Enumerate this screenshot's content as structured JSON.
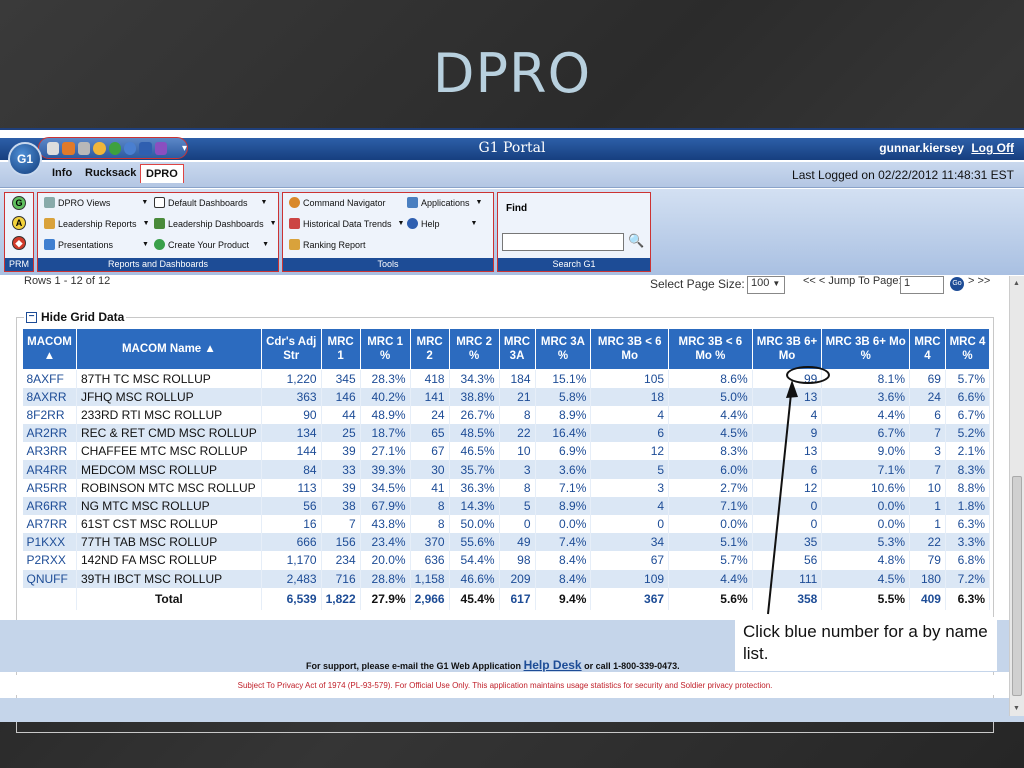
{
  "slide": {
    "title": "DPRO"
  },
  "portal": {
    "title": "G1 Portal",
    "logo": "G1",
    "user": "gunnar.kiersey",
    "logoff": "Log Off",
    "last_logged": "Last Logged on 02/22/2012 11:48:31 EST",
    "quick_icons": [
      "print-icon",
      "gear-icon",
      "tools-icon",
      "search-icon",
      "letter-u-icon",
      "letter-p-icon",
      "save-icon",
      "help-icon"
    ]
  },
  "tabs": [
    {
      "label": "Info"
    },
    {
      "label": "Rucksack"
    },
    {
      "label": "DPRO"
    }
  ],
  "ribbon": {
    "prm": {
      "label": "PRM",
      "icons": [
        "G",
        "A",
        "◆"
      ]
    },
    "reports": {
      "label": "Reports and Dashboards",
      "items": [
        {
          "label": "DPRO Views"
        },
        {
          "label": "Default Dashboards"
        },
        {
          "label": "Leadership Reports"
        },
        {
          "label": "Leadership Dashboards"
        },
        {
          "label": "Presentations"
        },
        {
          "label": "Create Your Product"
        }
      ]
    },
    "tools": {
      "label": "Tools",
      "items": [
        {
          "label": "Command Navigator"
        },
        {
          "label": "Applications"
        },
        {
          "label": "Historical Data Trends"
        },
        {
          "label": "Help"
        },
        {
          "label": "Ranking Report"
        }
      ]
    },
    "search": {
      "label": "Search G1",
      "find": "Find"
    }
  },
  "pager": {
    "rows_info": "Rows 1 - 12 of 12",
    "page_size_label": "Select Page Size:",
    "page_size": "100",
    "jump_label": "<< < Jump To Page:",
    "jump_value": "1",
    "go": "Go",
    "next": "> >>"
  },
  "grid": {
    "toggle_label": "Hide Grid Data",
    "headers": [
      "MACOM ▲",
      "MACOM Name ▲",
      "Cdr's Adj Str",
      "MRC 1",
      "MRC 1 %",
      "MRC 2",
      "MRC 2 %",
      "MRC 3A",
      "MRC 3A %",
      "MRC 3B < 6 Mo",
      "MRC 3B < 6 Mo %",
      "MRC 3B 6+ Mo",
      "MRC 3B 6+ Mo %",
      "MRC 4",
      "MRC 4 %"
    ],
    "rows": [
      [
        "8AXFF",
        "87TH TC MSC ROLLUP",
        "1,220",
        "345",
        "28.3%",
        "418",
        "34.3%",
        "184",
        "15.1%",
        "105",
        "8.6%",
        "99",
        "8.1%",
        "69",
        "5.7%"
      ],
      [
        "8AXRR",
        "JFHQ MSC ROLLUP",
        "363",
        "146",
        "40.2%",
        "141",
        "38.8%",
        "21",
        "5.8%",
        "18",
        "5.0%",
        "13",
        "3.6%",
        "24",
        "6.6%"
      ],
      [
        "8F2RR",
        "233RD RTI MSC ROLLUP",
        "90",
        "44",
        "48.9%",
        "24",
        "26.7%",
        "8",
        "8.9%",
        "4",
        "4.4%",
        "4",
        "4.4%",
        "6",
        "6.7%"
      ],
      [
        "AR2RR",
        "REC & RET CMD MSC ROLLUP",
        "134",
        "25",
        "18.7%",
        "65",
        "48.5%",
        "22",
        "16.4%",
        "6",
        "4.5%",
        "9",
        "6.7%",
        "7",
        "5.2%"
      ],
      [
        "AR3RR",
        "CHAFFEE MTC MSC ROLLUP",
        "144",
        "39",
        "27.1%",
        "67",
        "46.5%",
        "10",
        "6.9%",
        "12",
        "8.3%",
        "13",
        "9.0%",
        "3",
        "2.1%"
      ],
      [
        "AR4RR",
        "MEDCOM MSC ROLLUP",
        "84",
        "33",
        "39.3%",
        "30",
        "35.7%",
        "3",
        "3.6%",
        "5",
        "6.0%",
        "6",
        "7.1%",
        "7",
        "8.3%"
      ],
      [
        "AR5RR",
        "ROBINSON MTC MSC ROLLUP",
        "113",
        "39",
        "34.5%",
        "41",
        "36.3%",
        "8",
        "7.1%",
        "3",
        "2.7%",
        "12",
        "10.6%",
        "10",
        "8.8%"
      ],
      [
        "AR6RR",
        "NG MTC MSC ROLLUP",
        "56",
        "38",
        "67.9%",
        "8",
        "14.3%",
        "5",
        "8.9%",
        "4",
        "7.1%",
        "0",
        "0.0%",
        "1",
        "1.8%"
      ],
      [
        "AR7RR",
        "61ST CST MSC ROLLUP",
        "16",
        "7",
        "43.8%",
        "8",
        "50.0%",
        "0",
        "0.0%",
        "0",
        "0.0%",
        "0",
        "0.0%",
        "1",
        "6.3%"
      ],
      [
        "P1KXX",
        "77TH TAB MSC ROLLUP",
        "666",
        "156",
        "23.4%",
        "370",
        "55.6%",
        "49",
        "7.4%",
        "34",
        "5.1%",
        "35",
        "5.3%",
        "22",
        "3.3%"
      ],
      [
        "P2RXX",
        "142ND FA MSC ROLLUP",
        "1,170",
        "234",
        "20.0%",
        "636",
        "54.4%",
        "98",
        "8.4%",
        "67",
        "5.7%",
        "56",
        "4.8%",
        "79",
        "6.8%"
      ],
      [
        "QNUFF",
        "39TH IBCT MSC ROLLUP",
        "2,483",
        "716",
        "28.8%",
        "1,158",
        "46.6%",
        "209",
        "8.4%",
        "109",
        "4.4%",
        "111",
        "4.5%",
        "180",
        "7.2%"
      ]
    ],
    "total": [
      "",
      "Total",
      "6,539",
      "1,822",
      "27.9%",
      "2,966",
      "45.4%",
      "617",
      "9.4%",
      "367",
      "5.6%",
      "358",
      "5.5%",
      "409",
      "6.3%"
    ]
  },
  "footer": {
    "support_prefix": "For support, please e-mail the G1 Web Application",
    "help_desk": "Help Desk",
    "support_suffix": "or call 1-800-339-0473.",
    "privacy": "Subject To Privacy Act of 1974 (PL-93-579). For Official Use Only. This application maintains usage statistics for security and Soldier privacy protection."
  },
  "callout": "Click blue number for a by name list."
}
